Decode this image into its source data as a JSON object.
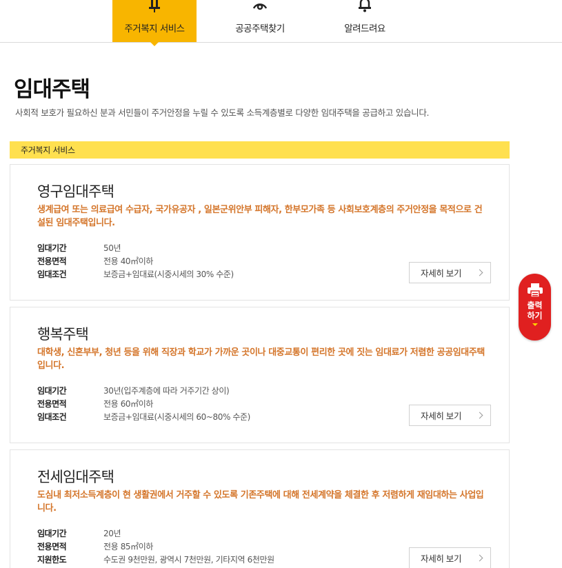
{
  "nav": {
    "tabs": [
      {
        "label": "주거복지 서비스",
        "icon": "signpost-icon",
        "active": true
      },
      {
        "label": "공공주택찾기",
        "icon": "location-pin-icon",
        "active": false
      },
      {
        "label": "알려드려요",
        "icon": "bell-icon",
        "active": false
      }
    ]
  },
  "page": {
    "title": "임대주택",
    "description": "사회적 보호가 필요하신 분과 서민들이 주거안정을 누릴 수 있도록 소득계층별로 다양한 임대주택을 공급하고 있습니다."
  },
  "section": {
    "label": "주거복지 서비스"
  },
  "cards": [
    {
      "title": "영구임대주택",
      "description": "생계급여 또는 의료급여 수급자, 국가유공자 , 일본군위안부 피해자, 한부모가족 등 사회보호계층의 주거안정을 목적으로 건설된 임대주택입니다.",
      "info": [
        {
          "label": "임대기간",
          "value": "50년"
        },
        {
          "label": "전용면적",
          "value": "전용 40㎡이하"
        },
        {
          "label": "임대조건",
          "value": "보증금+임대료(시중시세의 30% 수준)"
        }
      ],
      "button": "자세히 보기"
    },
    {
      "title": "행복주택",
      "description": "대학생, 신혼부부, 청년 등을 위해 직장과 학교가 가까운 곳이나 대중교통이 편리한 곳에 짓는 임대료가 저렴한 공공임대주택입니다.",
      "info": [
        {
          "label": "임대기간",
          "value": "30년(입주계층에 따라 거주기간 상이)"
        },
        {
          "label": "전용면적",
          "value": "전용 60㎡이하"
        },
        {
          "label": "임대조건",
          "value": "보증금+임대료(시중시세의 60~80% 수준)"
        }
      ],
      "button": "자세히 보기"
    },
    {
      "title": "전세임대주택",
      "description": "도심내 최저소득계층이 현 생활권에서 거주할 수 있도록 기존주택에 대해 전세계약을 체결한 후 저렴하게 재임대하는 사업입니다.",
      "info": [
        {
          "label": "임대기간",
          "value": "20년"
        },
        {
          "label": "전용면적",
          "value": "전용 85㎡이하"
        },
        {
          "label": "지원한도",
          "value": "수도권 9천만원, 광역시 7천만원, 기타지역 6천만원"
        }
      ],
      "button": "자세히 보기"
    }
  ],
  "print": {
    "label": "출력하기",
    "icon": "printer-icon"
  },
  "colors": {
    "accent": "#f8b500",
    "section_bar": "#ffe04f",
    "highlight_text": "#d4752a",
    "print_button": "#e02020"
  }
}
